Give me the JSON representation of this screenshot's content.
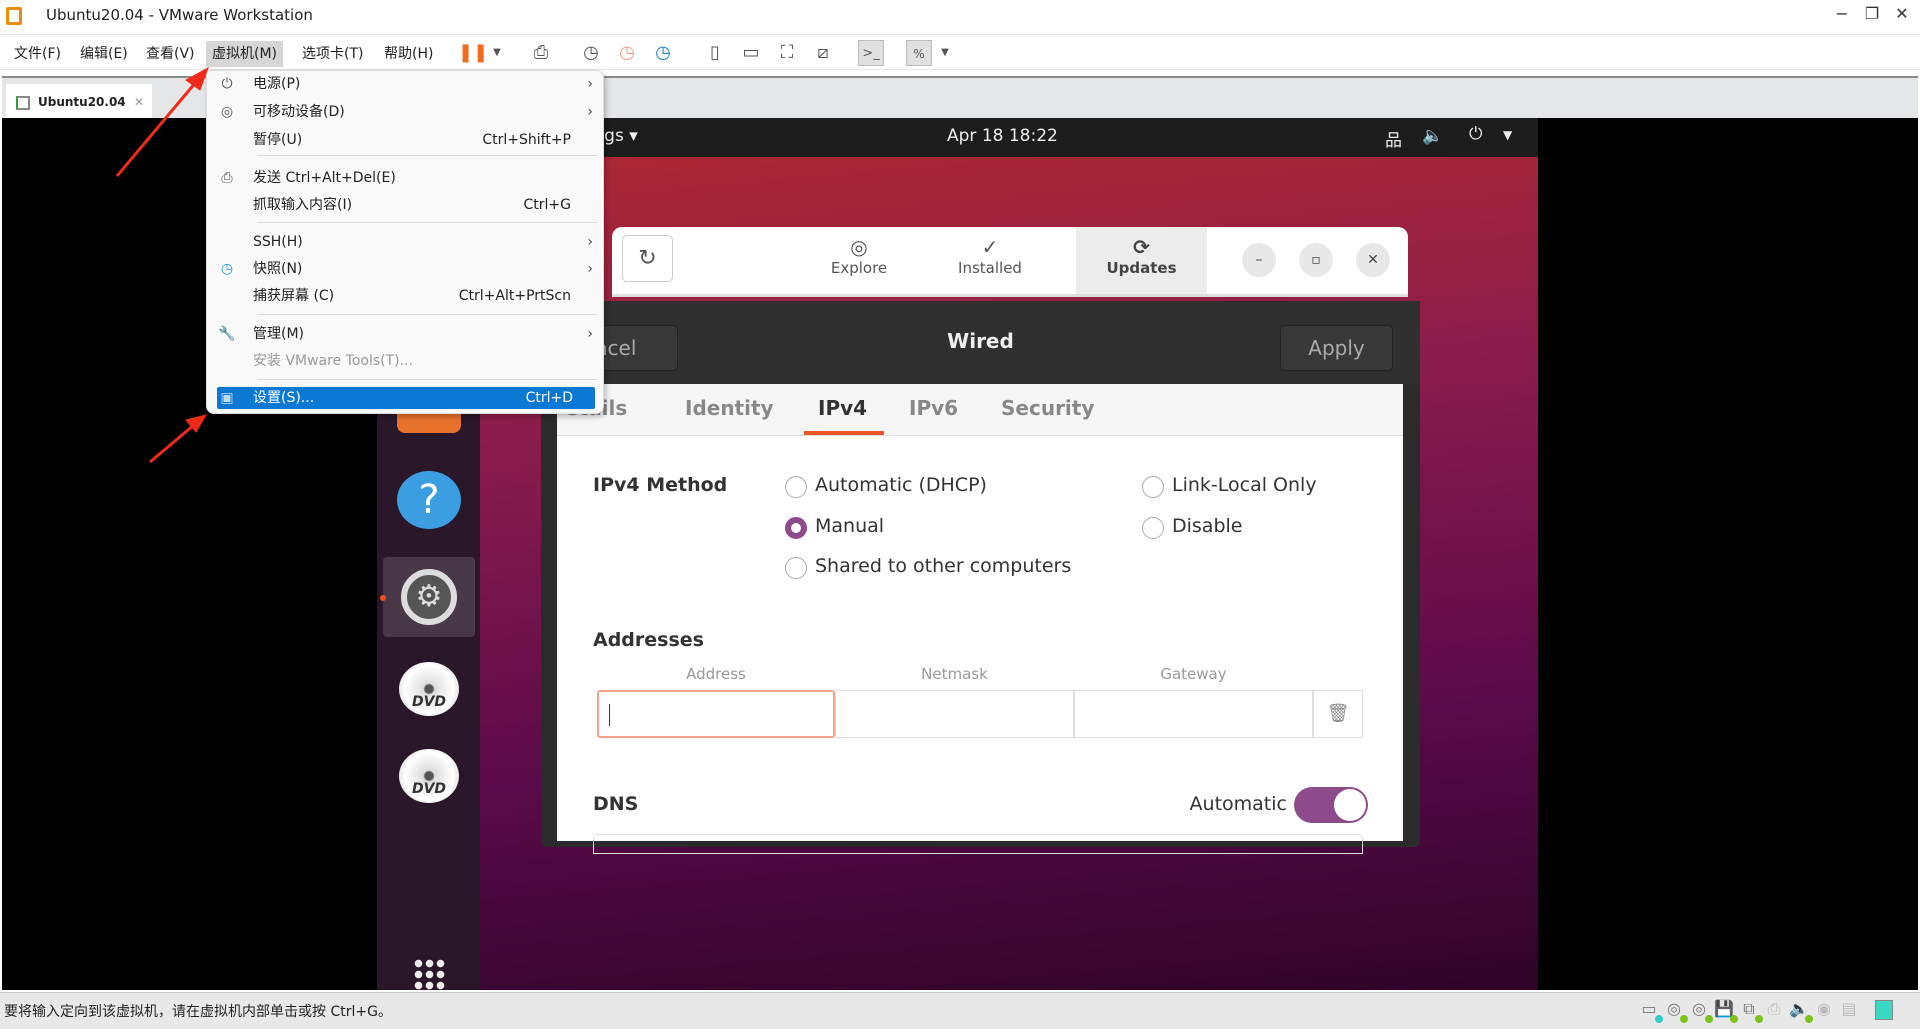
{
  "window": {
    "title": "Ubuntu20.04 - VMware Workstation",
    "controls": [
      "minimize",
      "restore",
      "close"
    ]
  },
  "menubar": {
    "items": [
      "文件(F)",
      "编辑(E)",
      "查看(V)",
      "虚拟机(M)",
      "选项卡(T)",
      "帮助(H)"
    ],
    "active": "虚拟机(M)"
  },
  "tabs": [
    {
      "label": "Ubuntu20.04"
    }
  ],
  "vm_menu": {
    "items": [
      {
        "label": "电源(P)",
        "icon": "power-icon",
        "submenu": true
      },
      {
        "label": "可移动设备(D)",
        "icon": "removable-device-icon",
        "submenu": true
      },
      {
        "label": "暂停(U)",
        "shortcut": "Ctrl+Shift+P"
      },
      {
        "label": "发送 Ctrl+Alt+Del(E)",
        "icon": "send-keys-icon"
      },
      {
        "label": "抓取输入内容(I)",
        "shortcut": "Ctrl+G"
      },
      {
        "label": "SSH(H)",
        "submenu": true
      },
      {
        "label": "快照(N)",
        "icon": "snapshot-icon",
        "submenu": true
      },
      {
        "label": "捕获屏幕 (C)",
        "shortcut": "Ctrl+Alt+PrtScn"
      },
      {
        "label": "管理(M)",
        "icon": "wrench-icon",
        "submenu": true
      },
      {
        "label": "安装 VMware Tools(T)...",
        "disabled": true
      },
      {
        "label": "设置(S)...",
        "shortcut": "Ctrl+D",
        "highlighted": true
      }
    ]
  },
  "ubuntu": {
    "topbar": {
      "app_menu": "tings ▾",
      "clock": "Apr 18  18:22"
    },
    "software": {
      "tabs": [
        "Explore",
        "Installed",
        "Updates"
      ],
      "active": "Updates"
    },
    "wired": {
      "title": "Wired",
      "cancel": "ancel",
      "apply": "Apply",
      "tabs": [
        "etails",
        "Identity",
        "IPv4",
        "IPv6",
        "Security"
      ],
      "active_tab": "IPv4",
      "method_label": "IPv4 Method",
      "methods": [
        "Automatic (DHCP)",
        "Manual",
        "Shared to other computers",
        "Link-Local Only",
        "Disable"
      ],
      "selected_method": "Manual",
      "addresses_label": "Addresses",
      "columns": [
        "Address",
        "Netmask",
        "Gateway"
      ],
      "address_value": "",
      "netmask_value": "",
      "gateway_value": "",
      "dns_label": "DNS",
      "dns_auto_label": "Automatic",
      "dns_auto": true,
      "accent": "#e95420",
      "toggle_color": "#8d4b8b"
    }
  },
  "statusbar": {
    "message": "要将输入定向到该虚拟机，请在虚拟机内部单击或按 Ctrl+G。"
  }
}
